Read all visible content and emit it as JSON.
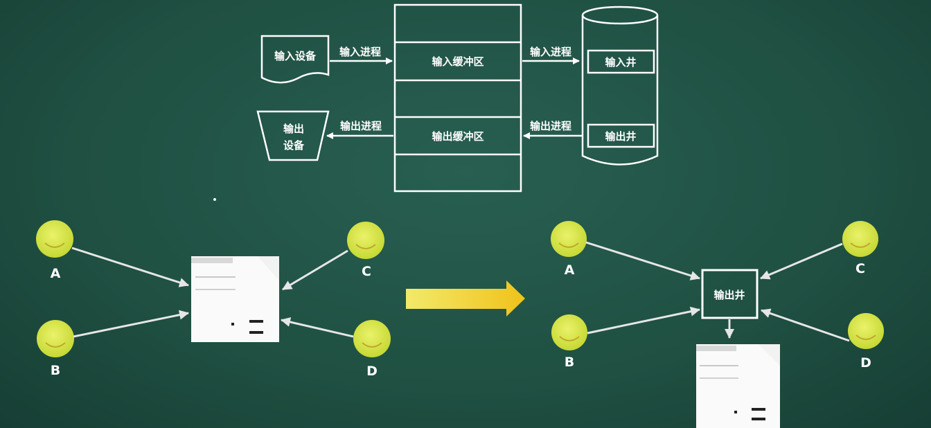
{
  "buffer": {
    "input_device": "输入设备",
    "output_device_line1": "输出",
    "output_device_line2": "设备",
    "input_process_left": "输入进程",
    "output_process_left": "输出进程",
    "input_process_right": "输入进程",
    "output_process_right": "输出进程",
    "input_buffer": "输入缓冲区",
    "output_buffer": "输出缓冲区",
    "input_well": "输入井",
    "output_well": "输出井"
  },
  "left_scene": {
    "a": "A",
    "b": "B",
    "c": "C",
    "d": "D"
  },
  "right_scene": {
    "a": "A",
    "b": "B",
    "c": "C",
    "d": "D",
    "well": "输出井"
  },
  "colors": {
    "board": "#1f5042",
    "smiley": "#d9e64a",
    "arrow": "#f1d93b"
  }
}
